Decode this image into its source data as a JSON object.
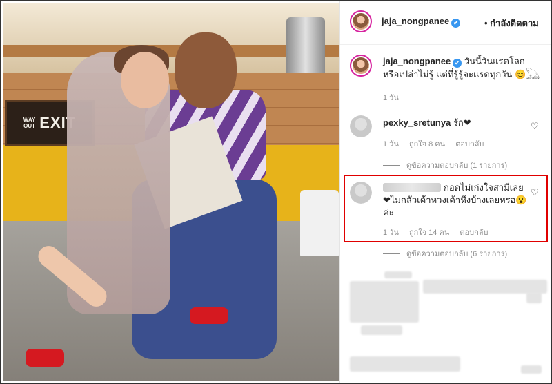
{
  "header": {
    "username": "jaja_nongpanee",
    "verified_mark": "✔",
    "separator": "•",
    "following_label": "กำลังติดตาม"
  },
  "photo": {
    "exit_sign": {
      "top_text": "WAY",
      "bottom_text": "OUT",
      "main_text": "EXIT"
    }
  },
  "caption": {
    "username": "jaja_nongpanee",
    "text": "วันนี้วันแรดโลก หรือเปล่าไม่รู้ แต่ที่รู้รู้จะแรดทุกวัน 😊𓆏",
    "time": "1 วัน"
  },
  "comments": [
    {
      "username": "pexky_sretunya",
      "text": "รัก❤",
      "time": "1 วัน",
      "likes": "ถูกใจ 8 คน",
      "reply_label": "ตอบกลับ",
      "view_replies": "ดูข้อความตอบกลับ (1 รายการ)"
    },
    {
      "username": "",
      "text": "กอดไม่เก่งใจสามีเลย ❤ไม่กลัวเค้าหวงเค้าหึงบ้างเลยหรอ😮 ค่ะ",
      "time": "1 วัน",
      "likes": "ถูกใจ 14 คน",
      "reply_label": "ตอบกลับ",
      "view_replies": "ดูข้อความตอบกลับ (6 รายการ)"
    }
  ],
  "icons": {
    "heart": "♡"
  },
  "colors": {
    "highlight": "#e00000",
    "verified": "#3897f0",
    "muted_text": "#8e8e8e"
  }
}
